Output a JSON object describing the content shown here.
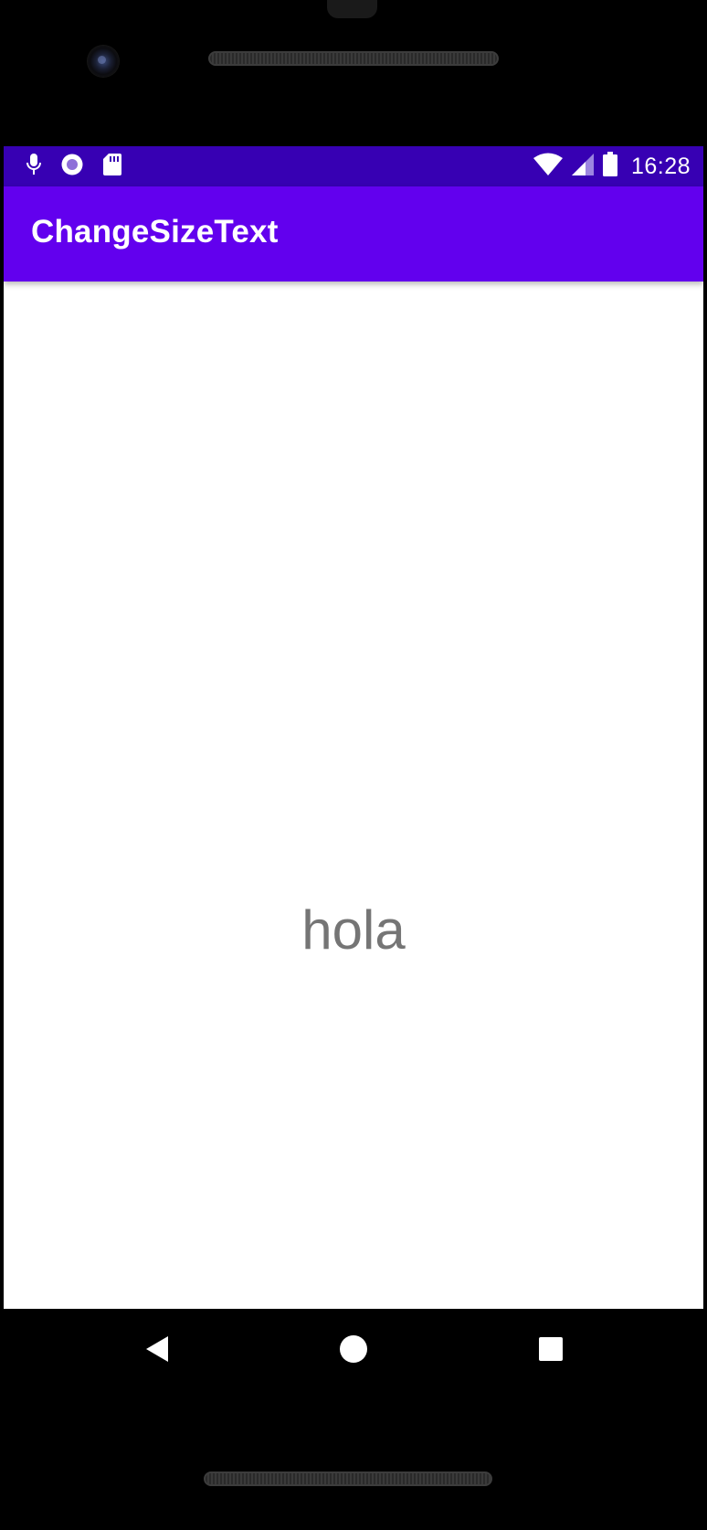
{
  "status_bar": {
    "time": "16:28",
    "left_icons": [
      "microphone-icon",
      "record-icon",
      "sd-card-icon"
    ],
    "right_icons": [
      "wifi-icon",
      "cellular-signal-icon",
      "battery-icon"
    ],
    "background_color": "#3700b3"
  },
  "app_bar": {
    "title": "ChangeSizeText",
    "background_color": "#6200ee"
  },
  "main": {
    "text": "hola",
    "text_color": "#757575"
  },
  "nav_bar": {
    "buttons": [
      "back",
      "home",
      "recents"
    ]
  }
}
